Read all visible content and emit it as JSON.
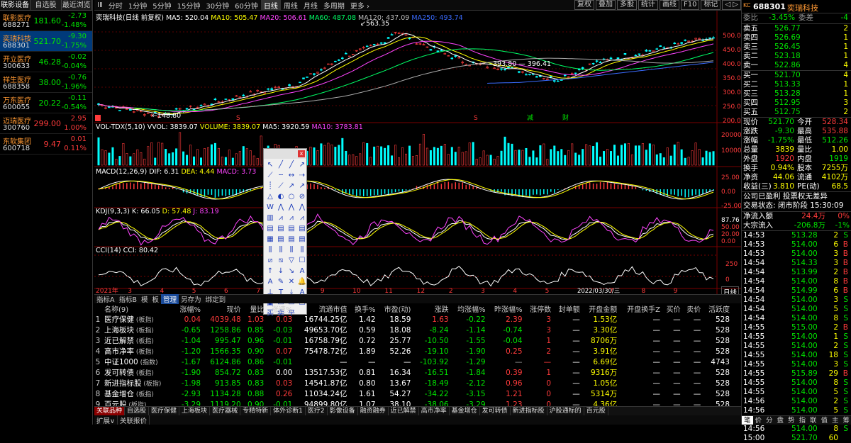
{
  "watchlist": {
    "tabs": [
      "联影设备",
      "自选股",
      "最近浏览"
    ],
    "items": [
      {
        "name": "联影医疗",
        "code": "688271",
        "price": "181.60",
        "change": "-2.73",
        "pct": "-1.48%",
        "dir": "down"
      },
      {
        "name": "奕瑞科技",
        "code": "688301",
        "price": "521.70",
        "change": "-9.30",
        "pct": "-1.75%",
        "dir": "down",
        "selected": true
      },
      {
        "name": "开立医疗",
        "code": "300633",
        "price": "46.28",
        "change": "-0.02",
        "pct": "-0.04%",
        "dir": "down"
      },
      {
        "name": "祥生医疗",
        "code": "688358",
        "price": "38.00",
        "change": "-0.76",
        "pct": "-1.96%",
        "dir": "down"
      },
      {
        "name": "万东医疗",
        "code": "600055",
        "price": "20.22",
        "change": "-0.11",
        "pct": "-0.54%",
        "dir": "down"
      },
      {
        "name": "迈瑞医疗",
        "code": "300760",
        "price": "299.00",
        "change": "2.95",
        "pct": "1.00%",
        "dir": "up"
      },
      {
        "name": "东软集团",
        "code": "600718",
        "price": "9.47",
        "change": "0.01",
        "pct": "0.11%",
        "dir": "up"
      }
    ]
  },
  "toolbar": {
    "items": [
      "ⅠⅡ",
      "分时",
      "1分钟",
      "5分钟",
      "15分钟",
      "30分钟",
      "60分钟",
      "日线",
      "周线",
      "月线",
      "多周期",
      "更多 ›"
    ],
    "active": "日线",
    "buttons": [
      "复权",
      "叠加",
      "多股",
      "统计",
      "画线",
      "F10",
      "标记",
      "◁ ▷"
    ]
  },
  "chart": {
    "price_legend": {
      "title": "奕瑞科技(日线 前复权)",
      "ma5": "MA5: 520.04",
      "ma10": "MA10: 505.47",
      "ma20": "MA20: 506.61",
      "ma60": "MA60: 487.08",
      "ma120": "MA120: 437.09",
      "ma250": "MA250: 493.74"
    },
    "price_annotations": {
      "high": "563.35",
      "low": "148.80",
      "mid1": "393.80",
      "mid2": "396.41"
    },
    "price_axis": [
      "500.0",
      "450.0",
      "400.0",
      "350.0",
      "300.0",
      "250.0",
      "200.0"
    ],
    "vol_legend": {
      "title": "VOL-TDX(5,10)",
      "vvol": "VVOL: 3839.07",
      "volume": "VOLUME: 3839.07",
      "ma5": "MA5: 3920.59",
      "ma10": "MA10: 3783.81"
    },
    "vol_axis": [
      "20000",
      "10000"
    ],
    "macd_legend": {
      "title": "MACD(12,26,9)",
      "dif": "DIF: 6.31",
      "dea": "DEA: 4.44",
      "macd": "MACD: 3.73"
    },
    "macd_axis": [
      "25.00",
      "0.00",
      "-25.00"
    ],
    "kdj_legend": {
      "title": "KDJ(9,3,3)",
      "k": "K: 66.05",
      "d": "D: 57.48",
      "j": "J: 83.19"
    },
    "kdj_axis": [
      "87.76",
      "50.00",
      "20.00",
      "0.00"
    ],
    "cci_legend": {
      "title": "CCI(14)",
      "cci": "CCI: 80.42"
    },
    "cci_axis": [
      "250",
      "0"
    ],
    "date_axis": [
      "2021年",
      "3",
      "4",
      "5",
      "6",
      "7",
      "8",
      "9",
      "10",
      "11",
      "12",
      "2",
      "3",
      "4",
      "5",
      "2022/03/30/三",
      "7",
      "8",
      "9"
    ],
    "period_label": "日线",
    "markers": [
      "S",
      "S",
      "S",
      "减",
      "财"
    ]
  },
  "draw_tools": [
    "↖",
    "╱",
    "╱",
    "↗",
    "⟋",
    "╌",
    "↔",
    "⇢",
    "┊",
    "⟋",
    "↗",
    "↗",
    "△",
    "◐",
    "○",
    "⊘",
    "W",
    "⋀",
    "⋀",
    "⋀",
    "▥",
    "⩘",
    "⩘",
    "⩘",
    "▤",
    "▤",
    "▤",
    "▤",
    "▦",
    "▤",
    "▤",
    "▤",
    "⫼",
    "⫼",
    "⫼",
    "⫼",
    "⧄",
    "⧅",
    "▽",
    "☐",
    "↑",
    "↓",
    "↘",
    "A",
    "A",
    "✎",
    "✕",
    "🔔",
    "⊥",
    "T",
    "⤓",
    "A",
    "▣",
    "▭",
    "▭",
    "☐",
    "买",
    "卖",
    "平"
  ],
  "index_bar": {
    "items": [
      "指标A",
      "指标B",
      "模",
      "板",
      "管理",
      "另存为",
      "绑定到"
    ],
    "active": "管理"
  },
  "table": {
    "headers": [
      "",
      "名称(9)",
      "涨幅%",
      "现价",
      "量比",
      "涨速%",
      "流通市值",
      "换手%",
      "市盈(动)",
      "涨跌",
      "均涨幅%",
      "昨涨幅%",
      "涨停数",
      "封单额",
      "开盘金额",
      "开盘换手Z",
      "买价",
      "卖价",
      "活跃度"
    ],
    "rows": [
      {
        "idx": "1",
        "name": "医疗保健",
        "type": "(板指)",
        "pct": "0.04",
        "price": "4039.48",
        "vr": "1.03",
        "spd": "0.03",
        "cap": "16744.25亿",
        "to": "1.42",
        "pe": "18.59",
        "chg": "1.63",
        "avg": "-0.22",
        "prev": "2.39",
        "lim": "3",
        "seal": "—",
        "open": "1.53亿",
        "oto": "—",
        "bid": "—",
        "ask": "—",
        "act": "528"
      },
      {
        "idx": "2",
        "name": "上海板块",
        "type": "(板指)",
        "pct": "-0.65",
        "price": "1258.86",
        "vr": "0.85",
        "spd": "-0.03",
        "cap": "49653.70亿",
        "to": "0.59",
        "pe": "18.08",
        "chg": "-8.24",
        "avg": "-1.14",
        "prev": "-0.74",
        "lim": "3",
        "seal": "—",
        "open": "3.30亿",
        "oto": "—",
        "bid": "—",
        "ask": "—",
        "act": "528"
      },
      {
        "idx": "3",
        "name": "近已解禁",
        "type": "(板指)",
        "pct": "-1.04",
        "price": "995.47",
        "vr": "0.96",
        "spd": "-0.01",
        "cap": "16758.79亿",
        "to": "0.72",
        "pe": "25.77",
        "chg": "-10.50",
        "avg": "-1.55",
        "prev": "-0.04",
        "lim": "1",
        "seal": "—",
        "open": "8706万",
        "oto": "—",
        "bid": "—",
        "ask": "—",
        "act": "528"
      },
      {
        "idx": "4",
        "name": "高市净率",
        "type": "(板指)",
        "pct": "-1.20",
        "price": "1566.35",
        "vr": "0.90",
        "spd": "0.07",
        "cap": "75478.72亿",
        "to": "1.89",
        "pe": "52.26",
        "chg": "-19.10",
        "avg": "-1.90",
        "prev": "0.25",
        "lim": "2",
        "seal": "—",
        "open": "3.91亿",
        "oto": "—",
        "bid": "—",
        "ask": "—",
        "act": "528"
      },
      {
        "idx": "5",
        "name": "中证1000",
        "type": "(指数)",
        "pct": "-1.67",
        "price": "6124.86",
        "vr": "0.86",
        "spd": "-0.01",
        "cap": "—",
        "to": "—",
        "pe": "—",
        "chg": "-103.92",
        "avg": "-1.29",
        "prev": "—",
        "lim": "—",
        "seal": "—",
        "open": "6.69亿",
        "oto": "—",
        "bid": "—",
        "ask": "—",
        "act": "4743"
      },
      {
        "idx": "6",
        "name": "发可转债",
        "type": "(板指)",
        "pct": "-1.90",
        "price": "854.72",
        "vr": "0.83",
        "spd": "0.00",
        "cap": "13517.53亿",
        "to": "0.81",
        "pe": "16.34",
        "chg": "-16.51",
        "avg": "-1.84",
        "prev": "0.39",
        "lim": "1",
        "seal": "—",
        "open": "9316万",
        "oto": "—",
        "bid": "—",
        "ask": "—",
        "act": "528"
      },
      {
        "idx": "7",
        "name": "新进指标股",
        "type": "(板指)",
        "pct": "-1.98",
        "price": "913.85",
        "vr": "0.83",
        "spd": "0.03",
        "cap": "14541.87亿",
        "to": "0.80",
        "pe": "13.67",
        "chg": "-18.49",
        "avg": "-2.12",
        "prev": "0.96",
        "lim": "0",
        "seal": "—",
        "open": "1.05亿",
        "oto": "—",
        "bid": "—",
        "ask": "—",
        "act": "528"
      },
      {
        "idx": "8",
        "name": "基金增仓",
        "type": "(板指)",
        "pct": "-2.93",
        "price": "1134.28",
        "vr": "0.88",
        "spd": "0.26",
        "cap": "11034.24亿",
        "to": "1.61",
        "pe": "54.27",
        "chg": "-34.22",
        "avg": "-3.15",
        "prev": "1.21",
        "lim": "0",
        "seal": "—",
        "open": "5314万",
        "oto": "—",
        "bid": "—",
        "ask": "—",
        "act": "528"
      },
      {
        "idx": "9",
        "name": "百元股",
        "type": "(板指)",
        "pct": "-3.29",
        "price": "1119.20",
        "vr": "0.90",
        "spd": "-0.01",
        "cap": "94899.80亿",
        "to": "1.07",
        "pe": "38.10",
        "chg": "-38.06",
        "avg": "-3.29",
        "prev": "1.23",
        "lim": "0",
        "seal": "—",
        "open": "4.36亿",
        "oto": "—",
        "bid": "—",
        "ask": "—",
        "act": "528"
      }
    ]
  },
  "bottom_tabs": [
    "关联品种",
    "自选股",
    "医疗保健",
    "上海板块",
    "医疗器械",
    "专精特新",
    "体外诊断1",
    "医疗2",
    "影像设备",
    "融资融券",
    "近已解禁",
    "高市净率",
    "基金增仓",
    "发可转债",
    "新进指标股",
    "沪股通标的",
    "百元股"
  ],
  "bottom_bar": [
    "扩展∨",
    "关联报价"
  ],
  "quote": {
    "code": "688301",
    "name": "奕瑞科技",
    "badge": "KC",
    "wb": {
      "label": "委比",
      "value": "-3.45%",
      "label2": "委差",
      "value2": "-4"
    },
    "asks": [
      {
        "l": "卖五",
        "p": "526.77",
        "v": "2"
      },
      {
        "l": "卖四",
        "p": "526.69",
        "v": "1"
      },
      {
        "l": "卖三",
        "p": "526.45",
        "v": "1"
      },
      {
        "l": "卖二",
        "p": "523.18",
        "v": "1"
      },
      {
        "l": "卖一",
        "p": "522.86",
        "v": "4"
      }
    ],
    "bids": [
      {
        "l": "买一",
        "p": "521.70",
        "v": "4"
      },
      {
        "l": "买二",
        "p": "513.33",
        "v": "1"
      },
      {
        "l": "买三",
        "p": "513.28",
        "v": "1"
      },
      {
        "l": "买四",
        "p": "512.95",
        "v": "3"
      },
      {
        "l": "买五",
        "p": "512.75",
        "v": "2"
      }
    ],
    "stats": [
      {
        "a": "现价",
        "av": "521.70",
        "b": "今开",
        "bv": "528.34"
      },
      {
        "a": "涨跌",
        "av": "-9.30",
        "b": "最高",
        "bv": "535.88"
      },
      {
        "a": "涨幅",
        "av": "-1.75%",
        "b": "最低",
        "bv": "512.26"
      },
      {
        "a": "总量",
        "av": "3839",
        "b": "量比",
        "bv": "1.00"
      },
      {
        "a": "外盘",
        "av": "1920",
        "b": "内盘",
        "bv": "1919"
      },
      {
        "a": "换手",
        "av": "0.94%",
        "b": "股本",
        "bv": "7255万"
      },
      {
        "a": "净资",
        "av": "44.06",
        "b": "流通",
        "bv": "4102万"
      },
      {
        "a": "收益(三)",
        "av": "3.810",
        "b": "PE(动)",
        "bv": "68.5"
      }
    ],
    "info1": "公司已盈利 投票权无差异",
    "info2": "交易状态: 闭市阶段 15:30:09",
    "flow": [
      {
        "l": "净流入额",
        "v": "24.4万",
        "p": "0%"
      },
      {
        "l": "大宗流入",
        "v": "-206.8万",
        "p": "-1%"
      }
    ],
    "ticks": [
      {
        "t": "14:53",
        "p": "513.28",
        "v": "2",
        "s": "S"
      },
      {
        "t": "14:53",
        "p": "514.00",
        "v": "6",
        "s": "B"
      },
      {
        "t": "14:53",
        "p": "514.00",
        "v": "3",
        "s": "B"
      },
      {
        "t": "14:54",
        "p": "514.33",
        "v": "3",
        "s": "B"
      },
      {
        "t": "14:54",
        "p": "513.99",
        "v": "2",
        "s": "B"
      },
      {
        "t": "14:54",
        "p": "514.00",
        "v": "8",
        "s": "B"
      },
      {
        "t": "14:54",
        "p": "514.99",
        "v": "6",
        "s": "B"
      },
      {
        "t": "14:54",
        "p": "514.00",
        "v": "3",
        "s": "S"
      },
      {
        "t": "14:54",
        "p": "514.00",
        "v": "5",
        "s": "S"
      },
      {
        "t": "14:54",
        "p": "514.00",
        "v": "8",
        "s": "S"
      },
      {
        "t": "14:55",
        "p": "515.00",
        "v": "2",
        "s": "B"
      },
      {
        "t": "14:55",
        "p": "514.00",
        "v": "1",
        "s": "S"
      },
      {
        "t": "14:55",
        "p": "514.00",
        "v": "2",
        "s": "S"
      },
      {
        "t": "14:55",
        "p": "514.00",
        "v": "18",
        "s": "S"
      },
      {
        "t": "14:55",
        "p": "514.00",
        "v": "3",
        "s": "S"
      },
      {
        "t": "14:55",
        "p": "515.89",
        "v": "29",
        "s": "B"
      },
      {
        "t": "14:55",
        "p": "514.00",
        "v": "8",
        "s": "S"
      },
      {
        "t": "14:55",
        "p": "514.00",
        "v": "5",
        "s": "S"
      },
      {
        "t": "14:56",
        "p": "514.00",
        "v": "2",
        "s": "S"
      },
      {
        "t": "14:56",
        "p": "514.00",
        "v": "5",
        "s": "S"
      },
      {
        "t": "14:56",
        "p": "514.07",
        "v": "28",
        "s": "B"
      },
      {
        "t": "14:56",
        "p": "514.00",
        "v": "8",
        "s": "S"
      },
      {
        "t": "15:00",
        "p": "521.70",
        "v": "60",
        "s": ""
      }
    ],
    "tabs": [
      "笔",
      "价",
      "分",
      "盘",
      "势",
      "指",
      "联",
      "值",
      "主",
      "筹"
    ]
  }
}
